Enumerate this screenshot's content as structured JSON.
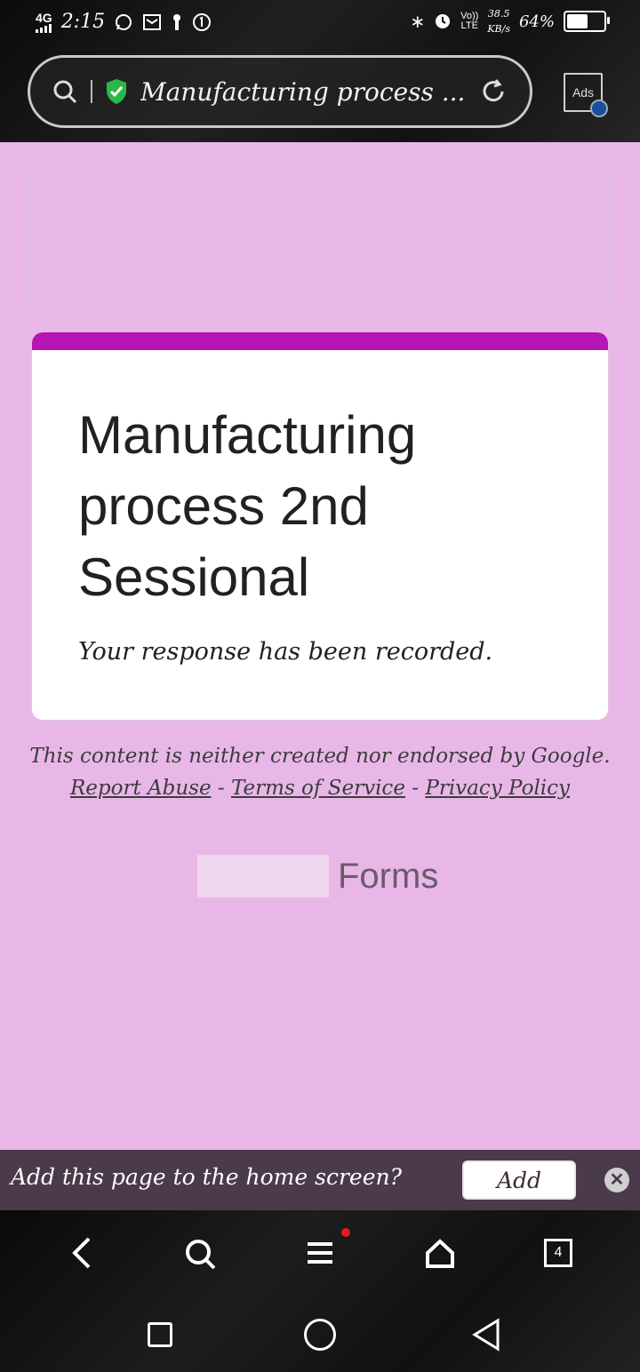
{
  "status": {
    "network": "4G",
    "time": "2:15",
    "volte_top": "Vo))",
    "volte_bottom": "LTE",
    "speed_value": "38.5",
    "speed_unit": "KB/s",
    "battery": "64%",
    "battery_level": 0.64
  },
  "browser": {
    "url_title": "Manufacturing process ...",
    "ads_label": "Ads"
  },
  "card": {
    "title": "Manufacturing process 2nd Sessional",
    "message": "Your response has been recorded."
  },
  "footer": {
    "disclaimer": "This content is neither created nor endorsed by Google.",
    "report_abuse": "Report Abuse",
    "terms": "Terms of Service",
    "privacy": "Privacy Policy",
    "separator": "-",
    "forms_label": "Forms"
  },
  "prompt": {
    "text": "Add this page to the home screen?",
    "add_label": "Add",
    "close_glyph": "✕"
  },
  "nav": {
    "tabs_count": "4"
  },
  "colors": {
    "page_bg": "#e8b7e8",
    "accent": "#b515b5",
    "prompt_bg": "#4a3a4a"
  }
}
